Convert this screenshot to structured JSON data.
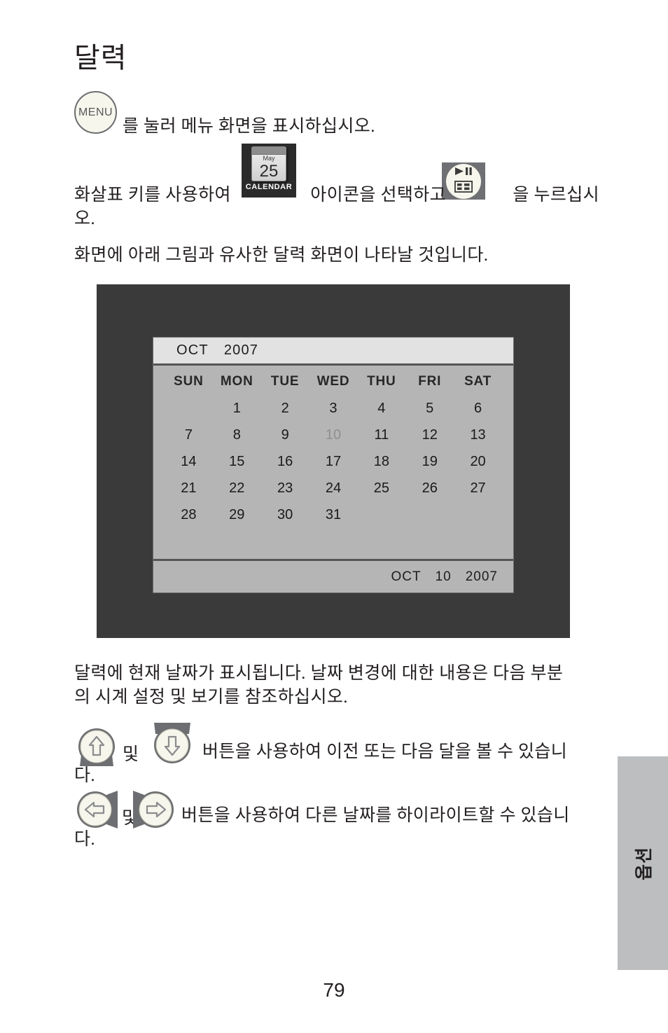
{
  "page": {
    "title": "달력",
    "page_number": "79",
    "side_tab_label": "옵션"
  },
  "steps": {
    "menu_button_label": "MENU",
    "line1": "를 눌러 메뉴 화면을 표시하십시오.",
    "line2_before": "화살표 키를 사용하여",
    "line2_middle": "아이콘을 선택하고",
    "line2_after": "을 누르십시",
    "line2_wrap": "오.",
    "line3": "화면에 아래 그림과 유사한 달력 화면이 나타날 것입니다."
  },
  "icons": {
    "calendar_tile": {
      "month": "May",
      "day": "25",
      "caption": "CALENDAR"
    },
    "play_pause_tile": {
      "name": "play-pause-icon"
    }
  },
  "screen": {
    "header": {
      "month": "OCT",
      "year": "2007"
    },
    "weekdays": [
      "SUN",
      "MON",
      "TUE",
      "WED",
      "THU",
      "FRI",
      "SAT"
    ],
    "leading_blanks": 1,
    "days": [
      1,
      2,
      3,
      4,
      5,
      6,
      7,
      8,
      9,
      10,
      11,
      12,
      13,
      14,
      15,
      16,
      17,
      18,
      19,
      20,
      21,
      22,
      23,
      24,
      25,
      26,
      27,
      28,
      29,
      30,
      31
    ],
    "selected_day": 10,
    "footer": {
      "month": "OCT",
      "day": "10",
      "year": "2007"
    }
  },
  "notes": {
    "line4": "달력에 현재 날짜가 표시됩니다.  날짜 변경에 대한 내용은 다음 부분\n의 시계 설정 및 보기를 참조하십시오.",
    "conjunction": "및",
    "line5a": "버튼을 사용하여 이전 또는 다음 달을 볼 수 있습니",
    "line5b": "다.",
    "line6a": "버튼을 사용하여 다른 날짜를 하이라이트할 수 있습니",
    "line6b": "다."
  },
  "colors": {
    "frame": "#3a3a3a",
    "screen_bg": "#b5b5b5",
    "screen_header": "#e2e2e2",
    "button_fill": "#f6f6ec",
    "button_stroke": "#6d6e71",
    "side_tab": "#bcbec0",
    "text": "#231f20",
    "selected_day": "#8f8f8f"
  }
}
